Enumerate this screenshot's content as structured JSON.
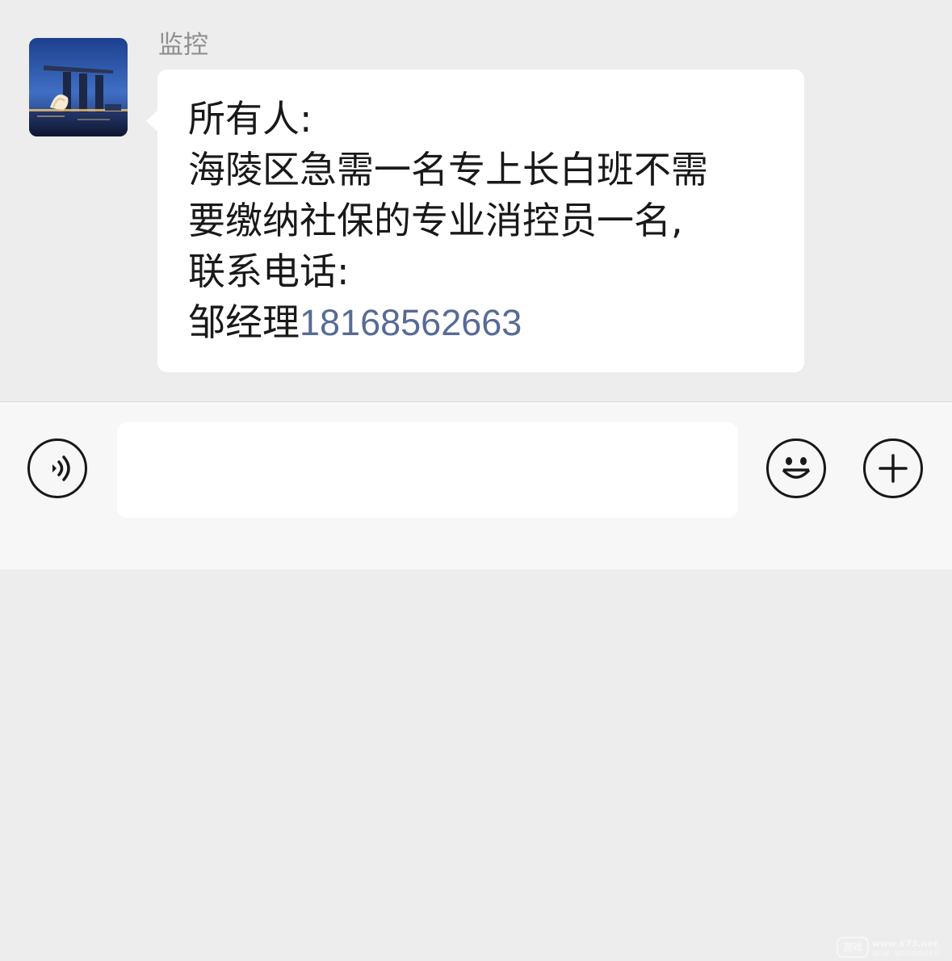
{
  "conversation": {
    "sender_name": "监控",
    "message": {
      "line1": "所有人:",
      "line2": "海陵区急需一名专上长白班不需",
      "line3": "要缴纳社保的专业消控员一名,",
      "line4": "联系电话:",
      "contact_prefix": "邹经理",
      "phone": "18168562663"
    },
    "link_color": "#576b95"
  },
  "input_bar": {
    "text_value": "",
    "voice_icon": "voice-icon",
    "emoji_icon": "emoji-icon",
    "plus_icon": "plus-icon"
  },
  "watermark": {
    "logo_text": "游戏",
    "url": "www.k73.net",
    "subtitle": "电玩城 · 最好玩的游戏平台"
  }
}
